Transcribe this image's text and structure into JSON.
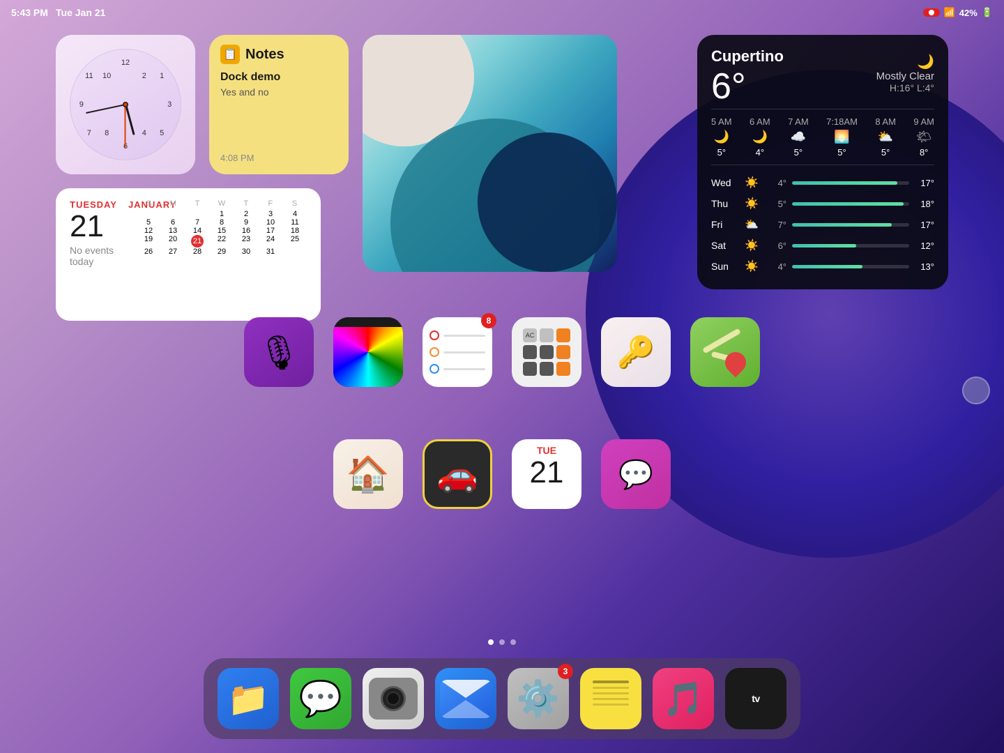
{
  "status_bar": {
    "time": "5:43 PM",
    "date": "Tue Jan 21",
    "record_label": "●",
    "battery": "42%",
    "wifi": true
  },
  "clock_widget": {
    "label": "Clock",
    "hour_rotation": 165,
    "minute_rotation": 258,
    "second_rotation": 180
  },
  "notes_widget": {
    "title": "Notes",
    "note_title": "Dock demo",
    "note_preview": "Yes and no",
    "timestamp": "4:08 PM"
  },
  "weather_widget": {
    "city": "Cupertino",
    "temp": "6°",
    "condition": "Mostly Clear",
    "high": "H:16°",
    "low": "L:4°",
    "hourly": [
      {
        "time": "5 AM",
        "icon": "🌙",
        "temp": "5°"
      },
      {
        "time": "6 AM",
        "icon": "🌙",
        "temp": "4°"
      },
      {
        "time": "7 AM",
        "icon": "☁️",
        "temp": "5°"
      },
      {
        "time": "7:18AM",
        "icon": "🌅",
        "temp": "5°"
      },
      {
        "time": "8 AM",
        "icon": "⛅",
        "temp": "5°"
      },
      {
        "time": "9 AM",
        "icon": "🌤",
        "temp": "8°"
      }
    ],
    "daily": [
      {
        "day": "Wed",
        "icon": "☀️",
        "low": "4°",
        "high": "17°",
        "bar_width": "90"
      },
      {
        "day": "Thu",
        "icon": "☀️",
        "low": "5°",
        "high": "18°",
        "bar_width": "95"
      },
      {
        "day": "Fri",
        "icon": "⛅",
        "low": "7°",
        "high": "17°",
        "bar_width": "85"
      },
      {
        "day": "Sat",
        "icon": "☀️",
        "low": "6°",
        "high": "12°",
        "bar_width": "55"
      },
      {
        "day": "Sun",
        "icon": "☀️",
        "low": "4°",
        "high": "13°",
        "bar_width": "60"
      }
    ]
  },
  "calendar_widget": {
    "day_label": "TUESDAY",
    "month_label": "JANUARY",
    "date": "21",
    "no_events": "No events today",
    "grid_headers": [
      "S",
      "M",
      "T",
      "W",
      "T",
      "F",
      "S"
    ],
    "grid_weeks": [
      [
        "",
        "",
        "",
        "1",
        "2",
        "3",
        "4"
      ],
      [
        "5",
        "6",
        "7",
        "8",
        "9",
        "10",
        "11"
      ],
      [
        "12",
        "13",
        "14",
        "15",
        "16",
        "17",
        "18"
      ],
      [
        "19",
        "20",
        "21",
        "22",
        "23",
        "24",
        "25"
      ],
      [
        "26",
        "27",
        "28",
        "29",
        "30",
        "31",
        ""
      ]
    ],
    "today": "21"
  },
  "apps_row1": [
    {
      "name": "Podcasts",
      "type": "podcasts"
    },
    {
      "name": "Color Meter",
      "type": "colormeter"
    },
    {
      "name": "Reminders",
      "type": "reminders",
      "badge": "8"
    },
    {
      "name": "Calculator",
      "type": "calculator"
    },
    {
      "name": "Passwords",
      "type": "passwords"
    },
    {
      "name": "Maps",
      "type": "maps"
    }
  ],
  "apps_row2": [
    {
      "name": "Home",
      "type": "home"
    },
    {
      "name": "Road Rush Cars",
      "type": "car"
    },
    {
      "name": "Calendar",
      "type": "calendar2"
    },
    {
      "name": "Speakout",
      "type": "speakout"
    }
  ],
  "page_dots": [
    {
      "active": true
    },
    {
      "active": false
    },
    {
      "active": false
    }
  ],
  "dock": [
    {
      "name": "Files",
      "type": "files"
    },
    {
      "name": "Messages",
      "type": "messages"
    },
    {
      "name": "Camera",
      "type": "camera"
    },
    {
      "name": "Mail",
      "type": "mail"
    },
    {
      "name": "Settings",
      "type": "settings",
      "badge": "3"
    },
    {
      "name": "Notes",
      "type": "notes_y"
    },
    {
      "name": "Music",
      "type": "music"
    },
    {
      "name": "Apple TV",
      "type": "appletv"
    }
  ]
}
